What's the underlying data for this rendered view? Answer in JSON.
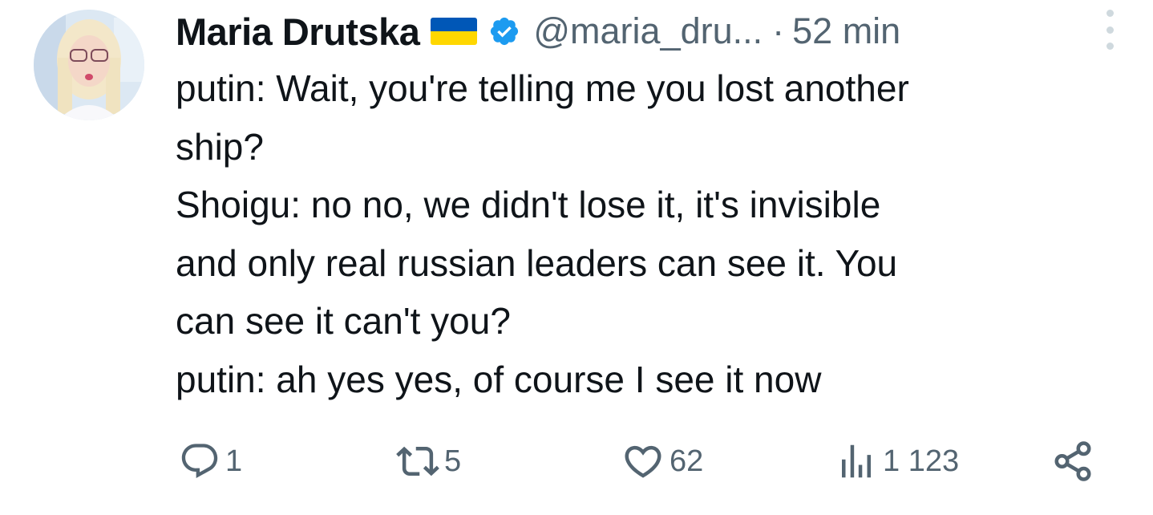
{
  "author": {
    "name": "Maria Drutska",
    "handle": "@maria_dru...",
    "separator": "·",
    "time": "52 min",
    "flag_icon": "ukraine-flag-icon",
    "verified_icon": "verified-badge-icon"
  },
  "tweet": {
    "lines": [
      "putin: Wait, you're telling me you lost another",
      "ship?",
      "Shoigu: no no, we didn't lose it, it's invisible",
      "and only real russian leaders can see it. You",
      "can see it can't you?",
      "putin: ah yes yes, of course I see it now"
    ]
  },
  "actions": {
    "reply": {
      "icon": "reply-icon",
      "count": "1"
    },
    "retweet": {
      "icon": "retweet-icon",
      "count": "5"
    },
    "like": {
      "icon": "heart-icon",
      "count": "62"
    },
    "views": {
      "icon": "views-icon",
      "count": "1 123"
    },
    "share": {
      "icon": "share-icon"
    }
  },
  "colors": {
    "text": "#0f1419",
    "secondary": "#536471",
    "verified": "#1d9bf0",
    "flag_blue": "#0057b7",
    "flag_yellow": "#ffd700"
  }
}
